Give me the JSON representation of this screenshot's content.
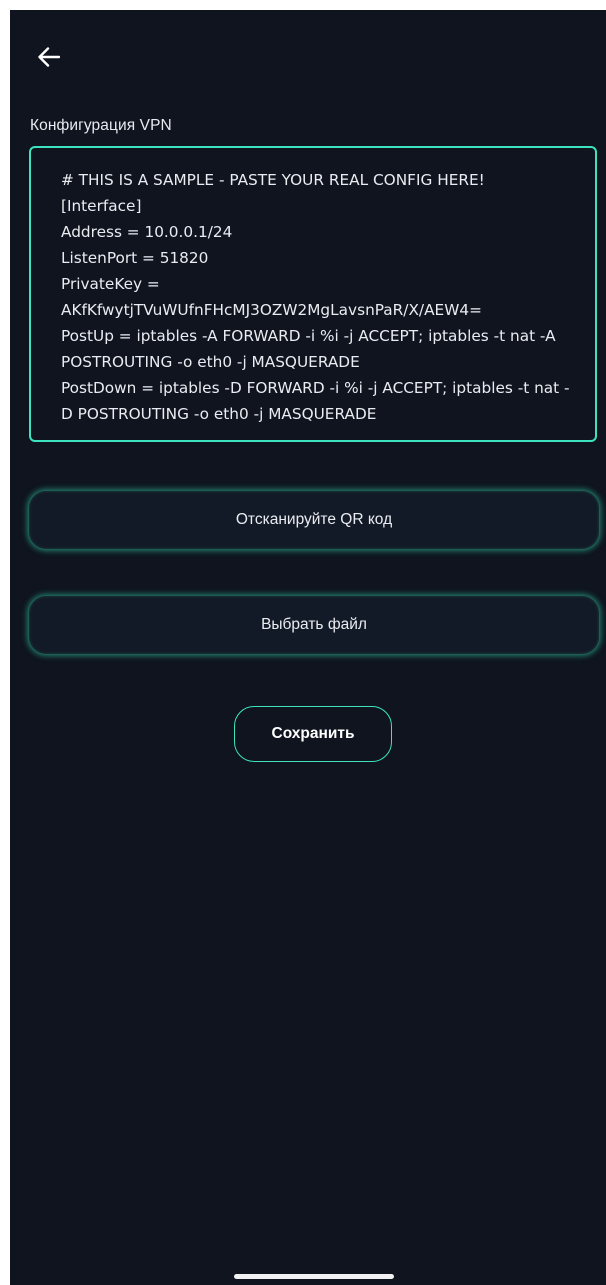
{
  "header": {
    "back_icon": "arrow-left-icon"
  },
  "config": {
    "label": "Конфигурация VPN",
    "value": "# THIS IS A SAMPLE - PASTE YOUR REAL CONFIG HERE!\n[Interface]\nAddress = 10.0.0.1/24\nListenPort = 51820\nPrivateKey =\nAKfKfwytjTVuWUfnFHcMJ3OZW2MgLavsnPaR/X/AEW4=\nPostUp = iptables -A FORWARD -i %i -j ACCEPT; iptables -t nat -A POSTROUTING -o eth0 -j MASQUERADE\nPostDown = iptables -D FORWARD -i %i -j ACCEPT; iptables -t nat -D POSTROUTING -o eth0 -j MASQUERADE"
  },
  "actions": {
    "scan_qr_label": "Отсканируйте QR код",
    "choose_file_label": "Выбрать файл",
    "save_label": "Сохранить"
  },
  "colors": {
    "background": "#0f141f",
    "accent": "#3be4bf",
    "text": "#e9ecf0"
  }
}
